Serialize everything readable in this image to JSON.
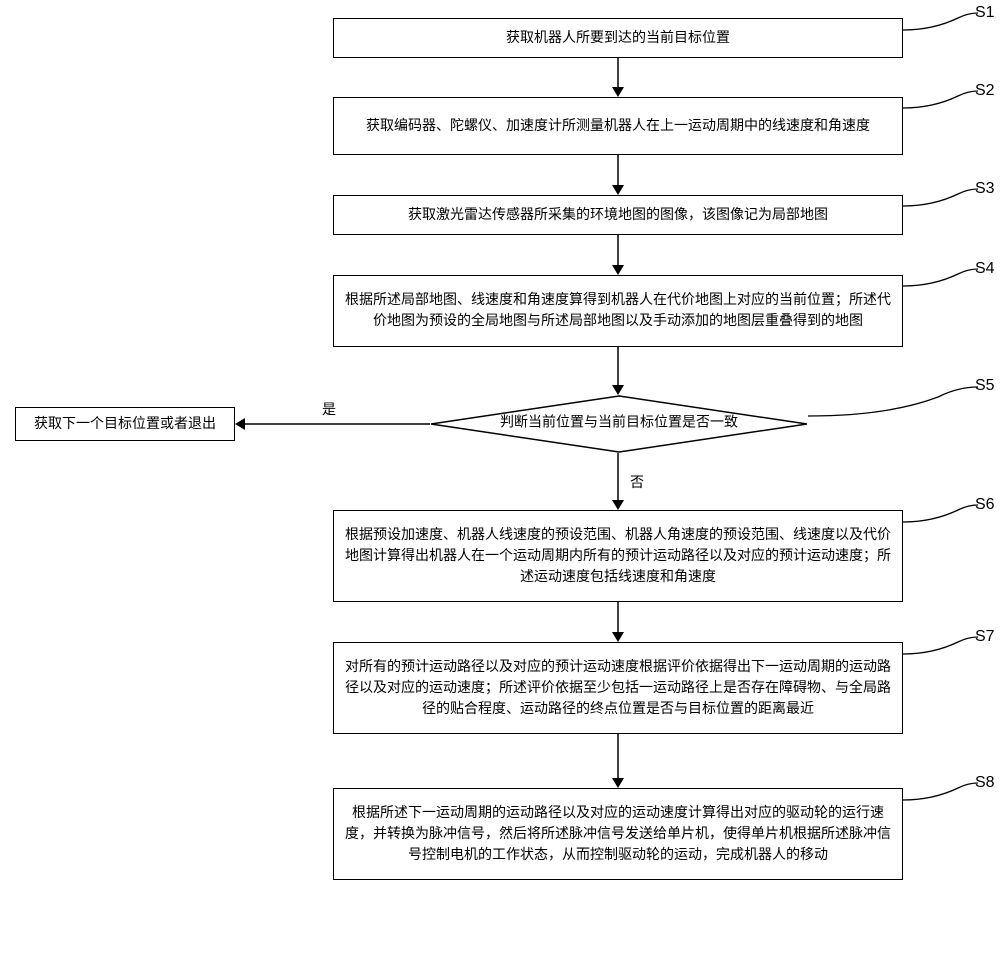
{
  "chart_data": {
    "type": "flowchart",
    "nodes": [
      {
        "id": "S1",
        "type": "process",
        "text": "获取机器人所要到达的当前目标位置"
      },
      {
        "id": "S2",
        "type": "process",
        "text": "获取编码器、陀螺仪、加速度计所测量机器人在上一运动周期中的线速度和角速度"
      },
      {
        "id": "S3",
        "type": "process",
        "text": "获取激光雷达传感器所采集的环境地图的图像，该图像记为局部地图"
      },
      {
        "id": "S4",
        "type": "process",
        "text": "根据所述局部地图、线速度和角速度算得到机器人在代价地图上对应的当前位置；所述代价地图为预设的全局地图与所述局部地图以及手动添加的地图层重叠得到的地图"
      },
      {
        "id": "S5",
        "type": "decision",
        "text": "判断当前位置与当前目标位置是否一致"
      },
      {
        "id": "EXIT",
        "type": "process",
        "text": "获取下一个目标位置或者退出"
      },
      {
        "id": "S6",
        "type": "process",
        "text": "根据预设加速度、机器人线速度的预设范围、机器人角速度的预设范围、线速度以及代价地图计算得出机器人在一个运动周期内所有的预计运动路径以及对应的预计运动速度；所述运动速度包括线速度和角速度"
      },
      {
        "id": "S7",
        "type": "process",
        "text": "对所有的预计运动路径以及对应的预计运动速度根据评价依据得出下一运动周期的运动路径以及对应的运动速度；所述评价依据至少包括一运动路径上是否存在障碍物、与全局路径的贴合程度、运动路径的终点位置是否与目标位置的距离最近"
      },
      {
        "id": "S8",
        "type": "process",
        "text": "根据所述下一运动周期的运动路径以及对应的运动速度计算得出对应的驱动轮的运行速度，并转换为脉冲信号，然后将所述脉冲信号发送给单片机，使得单片机根据所述脉冲信号控制电机的工作状态，从而控制驱动轮的运动，完成机器人的移动"
      }
    ],
    "edges": [
      {
        "from": "S1",
        "to": "S2"
      },
      {
        "from": "S2",
        "to": "S3"
      },
      {
        "from": "S3",
        "to": "S4"
      },
      {
        "from": "S4",
        "to": "S5"
      },
      {
        "from": "S5",
        "to": "EXIT",
        "label": "是"
      },
      {
        "from": "S5",
        "to": "S6",
        "label": "否"
      },
      {
        "from": "S6",
        "to": "S7"
      },
      {
        "from": "S7",
        "to": "S8"
      }
    ]
  },
  "labels": {
    "S1": "S1",
    "S2": "S2",
    "S3": "S3",
    "S4": "S4",
    "S5": "S5",
    "S6": "S6",
    "S7": "S7",
    "S8": "S8"
  },
  "edge_labels": {
    "yes": "是",
    "no": "否"
  }
}
